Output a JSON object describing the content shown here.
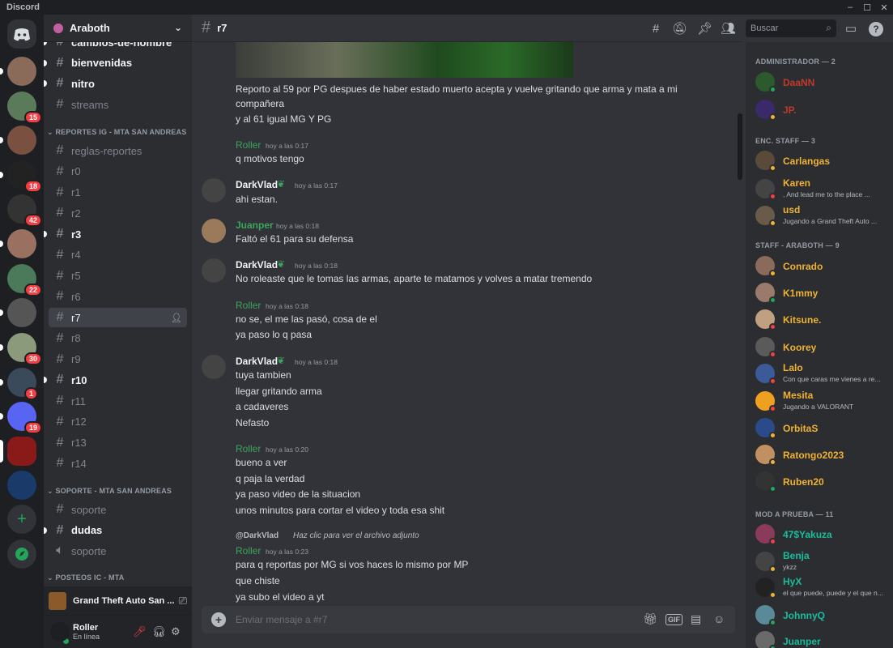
{
  "window": {
    "title": "Discord",
    "controls": [
      "–",
      "☐",
      "✕"
    ]
  },
  "rail": {
    "home_icon": "discord-logo-icon",
    "servers": [
      {
        "color": "#8a6b5a",
        "badge": "",
        "unread": true
      },
      {
        "color": "#5a7a5a",
        "badge": "15",
        "unread": false
      },
      {
        "color": "#7a5040",
        "badge": "",
        "unread": true
      },
      {
        "color": "#222222",
        "badge": "18",
        "unread": true
      },
      {
        "color": "#333333",
        "badge": "42",
        "unread": false
      },
      {
        "color": "#9a7060",
        "badge": "",
        "unread": true
      },
      {
        "color": "#4a7a5a",
        "badge": "22",
        "unread": false
      },
      {
        "color": "#555555",
        "badge": "",
        "unread": true
      },
      {
        "color": "#8a9a7a",
        "badge": "30",
        "unread": true
      },
      {
        "color": "#3a4a5a",
        "badge": "1",
        "unread": true
      },
      {
        "color": "#5865f2",
        "badge": "19",
        "unread": true
      },
      {
        "color": "#8a1a1a",
        "badge": "",
        "unread": false,
        "selected": true
      },
      {
        "color": "#1a3a6a",
        "badge": "",
        "unread": false
      }
    ],
    "add_server_icon": "plus-icon",
    "explore_icon": "compass-icon"
  },
  "guild": {
    "name": "Araboth"
  },
  "channels": {
    "items_top": [
      {
        "name": "cambios-de-nombre",
        "unread": true
      },
      {
        "name": "bienvenidas",
        "unread": true
      },
      {
        "name": "nitro",
        "unread": true
      },
      {
        "name": "streams",
        "unread": false
      }
    ],
    "cat1": "REPORTES IG - MTA SAN ANDREAS",
    "reports": [
      {
        "name": "reglas-reportes",
        "unread": false
      },
      {
        "name": "r0",
        "unread": false
      },
      {
        "name": "r1",
        "unread": false
      },
      {
        "name": "r2",
        "unread": false
      },
      {
        "name": "r3",
        "unread": true
      },
      {
        "name": "r4",
        "unread": false
      },
      {
        "name": "r5",
        "unread": false
      },
      {
        "name": "r6",
        "unread": false
      },
      {
        "name": "r7",
        "unread": false,
        "selected": true
      },
      {
        "name": "r8",
        "unread": false
      },
      {
        "name": "r9",
        "unread": false
      },
      {
        "name": "r10",
        "unread": true
      },
      {
        "name": "r11",
        "unread": false
      },
      {
        "name": "r12",
        "unread": false
      },
      {
        "name": "r13",
        "unread": false
      },
      {
        "name": "r14",
        "unread": false
      }
    ],
    "cat2": "SOPORTE - MTA SAN ANDREAS",
    "support": [
      {
        "name": "soporte",
        "unread": false,
        "type": "text"
      },
      {
        "name": "dudas",
        "unread": true,
        "type": "text"
      },
      {
        "name": "soporte",
        "unread": false,
        "type": "voice"
      }
    ],
    "cat3": "POSTEOS IC - MTA"
  },
  "activity": {
    "title": "Grand Theft Auto San ..."
  },
  "user": {
    "name": "Roller",
    "status": "En línea"
  },
  "chat": {
    "channel": "r7",
    "search_placeholder": "Buscar",
    "composer_placeholder": "Enviar mensaje a #r7",
    "messages": [
      {
        "lines": [
          "Reporto al 59 por PG despues de haber estado muerto acepta y vuelve gritando que arma y mata a mi",
          "compañera",
          "y al 61 igual MG Y PG"
        ]
      },
      {
        "author": "Roller",
        "time": "hoy a las 0:17",
        "lines": [
          "q motivos tengo"
        ]
      },
      {
        "author": "DarkVlad",
        "time": "hoy a las 0:17",
        "lines": [
          "ahi estan."
        ]
      },
      {
        "author": "Juanper",
        "time": "hoy a las 0:18",
        "lines": [
          "Faltó el 61 para su defensa"
        ]
      },
      {
        "author": "DarkVlad",
        "time": "hoy a las 0:18",
        "lines": [
          "No roleaste que le tomas las armas, aparte te matamos y volves a matar tremendo"
        ]
      },
      {
        "author": "Roller",
        "time": "hoy a las 0:18",
        "lines": [
          "no se, el me las pasó, cosa de el",
          "ya paso lo q pasa"
        ]
      },
      {
        "author": "DarkVlad",
        "time": "hoy a las 0:18",
        "lines": [
          "tuya tambien",
          "llegar gritando arma",
          "a cadaveres",
          "Nefasto"
        ]
      },
      {
        "author": "Roller",
        "time": "hoy a las 0:20",
        "lines": [
          "bueno a ver",
          "q paja la verdad",
          "ya paso video de la situacion",
          "unos minutos para cortar el video y toda esa shit"
        ]
      },
      {
        "reply_author": "@DarkVlad",
        "reply_text": "Haz clic para ver el archivo adjunto",
        "author": "Roller",
        "time": "hoy a las 0:23",
        "lines": [
          "para q reportas por MG si vos haces lo mismo por MP",
          "que chiste",
          "ya subo el video a yt"
        ]
      }
    ]
  },
  "members": {
    "groups": [
      {
        "header": "ADMINISTRADOR — 2",
        "members": [
          {
            "name": "DaaNN",
            "color": "#c0392b",
            "status": "on",
            "sub": ""
          },
          {
            "name": "JP.",
            "color": "#c0392b",
            "status": "idle",
            "sub": ""
          }
        ]
      },
      {
        "header": "ENC. STAFF — 3",
        "members": [
          {
            "name": "Carlangas",
            "color": "#f0b232",
            "status": "idle",
            "sub": ""
          },
          {
            "name": "Karen",
            "color": "#f0b232",
            "status": "dnd",
            "sub": ", And lead me to the place ..."
          },
          {
            "name": "usd",
            "color": "#f0b232",
            "status": "idle",
            "sub": "Jugando a Grand Theft Auto ..."
          }
        ]
      },
      {
        "header": "STAFF - ARABOTH — 9",
        "members": [
          {
            "name": "Conrado",
            "color": "#f0b232",
            "status": "idle",
            "sub": ""
          },
          {
            "name": "K1mmy",
            "color": "#f0b232",
            "status": "on",
            "sub": ""
          },
          {
            "name": "Kitsune.",
            "color": "#f0b232",
            "status": "dnd",
            "sub": ""
          },
          {
            "name": "Koorey",
            "color": "#f0b232",
            "status": "dnd",
            "sub": ""
          },
          {
            "name": "Lalo",
            "color": "#f0b232",
            "status": "dnd",
            "sub": "Con que caras me vienes a re..."
          },
          {
            "name": "Mesita",
            "color": "#f0b232",
            "status": "dnd",
            "sub": "Jugando a VALORANT"
          },
          {
            "name": "OrbitaS",
            "color": "#f0b232",
            "status": "idle",
            "sub": ""
          },
          {
            "name": "Ratongo2023",
            "color": "#f0b232",
            "status": "idle",
            "sub": ""
          },
          {
            "name": "Ruben20",
            "color": "#f0b232",
            "status": "on",
            "sub": ""
          }
        ]
      },
      {
        "header": "MOD A PRUEBA — 11",
        "members": [
          {
            "name": "47$Yakuza",
            "color": "#1abc9c",
            "status": "dnd",
            "sub": ""
          },
          {
            "name": "Benja",
            "color": "#1abc9c",
            "status": "idle",
            "sub": "ykzz"
          },
          {
            "name": "HyX",
            "color": "#1abc9c",
            "status": "idle",
            "sub": "el que puede, puede y el que n..."
          },
          {
            "name": "JohnnyQ",
            "color": "#1abc9c",
            "status": "on",
            "sub": ""
          },
          {
            "name": "Juanper",
            "color": "#1abc9c",
            "status": "on",
            "sub": ""
          }
        ]
      }
    ]
  },
  "colors": {
    "roller": "#3ba55c",
    "darkvlad": "#f2f3f5",
    "juanper": "#3ba55c",
    "accent": "#5865f2"
  }
}
